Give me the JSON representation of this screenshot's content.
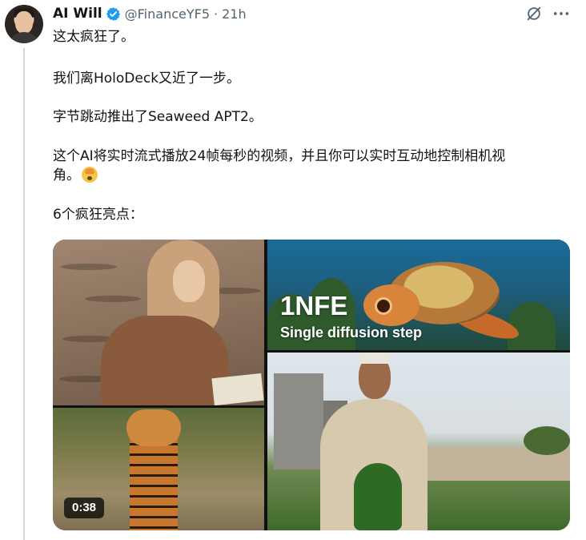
{
  "author": {
    "name": "AI Will",
    "handle": "@FinanceYF5",
    "separator": "·",
    "time": "21h"
  },
  "tweet": {
    "lines": [
      "这太疯狂了。",
      "我们离HoloDeck又近了一步。",
      "字节跳动推出了Seaweed APT2。",
      "这个AI将实时流式播放24帧每秒的视频，并且你可以实时互动地控制相机视",
      "角。",
      "6个疯狂亮点："
    ]
  },
  "media": {
    "overlay_title": "1NFE",
    "overlay_subtitle": "Single diffusion step",
    "duration": "0:38"
  },
  "icons": {
    "verified": "verified-badge-icon",
    "grok": "grok-icon",
    "more": "more-icon"
  },
  "colors": {
    "verified_blue": "#1d9bf0",
    "secondary_text": "#536471",
    "thread_line": "#cfd9de"
  }
}
